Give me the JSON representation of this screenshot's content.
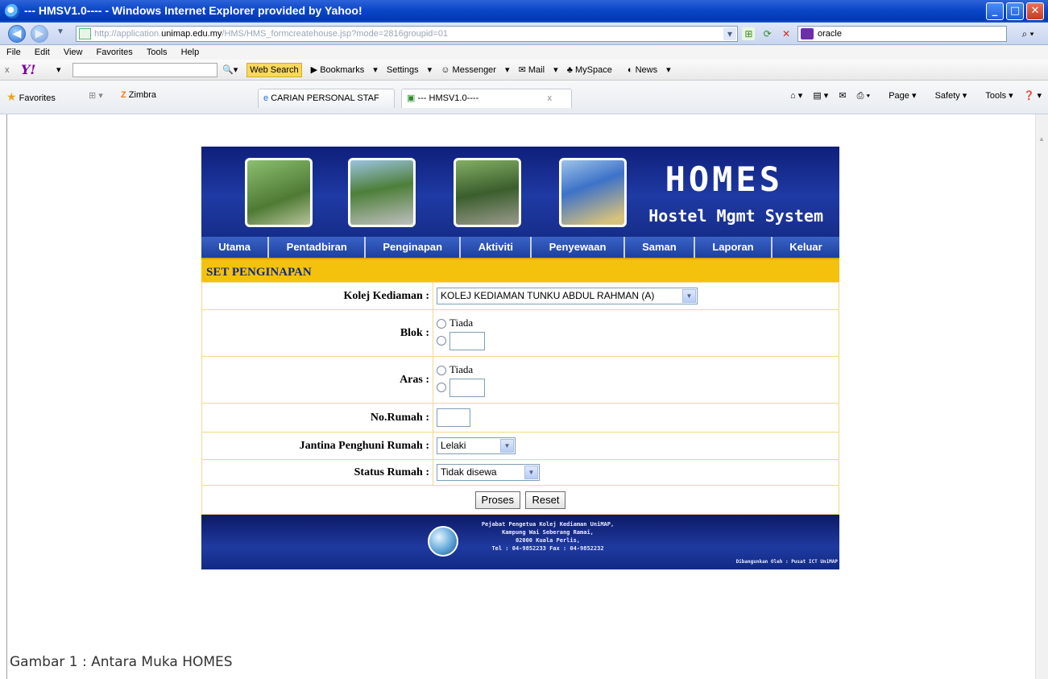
{
  "window": {
    "title": "--- HMSV1.0---- - Windows Internet Explorer provided by Yahoo!",
    "url_prefix": "http://application.",
    "url_host": "unimap.edu.my",
    "url_path": "/HMS/HMS_formcreatehouse.jsp?mode=2816groupid=01",
    "search_value": "oracle"
  },
  "menu": [
    "File",
    "Edit",
    "View",
    "Favorites",
    "Tools",
    "Help"
  ],
  "yahoo_toolbar": {
    "web_search": "Web Search",
    "bookmarks": "Bookmarks",
    "settings": "Settings",
    "messenger": "Messenger",
    "mail": "Mail",
    "myspace": "MySpace",
    "news": "News"
  },
  "tabs": {
    "favorites": "Favorites",
    "zimbra": "Zimbra",
    "carian": "CARIAN PERSONAL STAF",
    "active": "--- HMSV1.0----"
  },
  "command_bar": {
    "page": "Page",
    "safety": "Safety",
    "tools": "Tools"
  },
  "app": {
    "brand_title": "HOMES",
    "brand_subtitle": "Hostel Mgmt System",
    "nav": [
      "Utama",
      "Pentadbiran",
      "Penginapan",
      "Aktiviti",
      "Penyewaan",
      "Saman",
      "Laporan",
      "Keluar"
    ],
    "section_title": "SET PENGINAPAN",
    "form": {
      "kolej_label": "Kolej Kediaman :",
      "kolej_value": "KOLEJ KEDIAMAN TUNKU ABDUL RAHMAN (A)",
      "blok_label": "Blok :",
      "aras_label": "Aras :",
      "tiada": "Tiada",
      "norumah_label": "No.Rumah :",
      "jantina_label": "Jantina Penghuni Rumah :",
      "jantina_value": "Lelaki",
      "status_label": "Status Rumah :",
      "status_value": "Tidak disewa",
      "proses": "Proses",
      "reset": "Reset"
    },
    "footer": {
      "line1": "Pejabat Pengetua Kolej Kediaman UniMAP,",
      "line2": "Kampung Wai Seberang Ramai,",
      "line3": "02000 Kuala Perlis,",
      "line4": "Tel : 04-9852233 Fax : 04-9852232",
      "credit": "Dibangunkan Oleh : Pusat ICT UniMAP"
    }
  },
  "caption": "Gambar 1 : Antara Muka HOMES"
}
